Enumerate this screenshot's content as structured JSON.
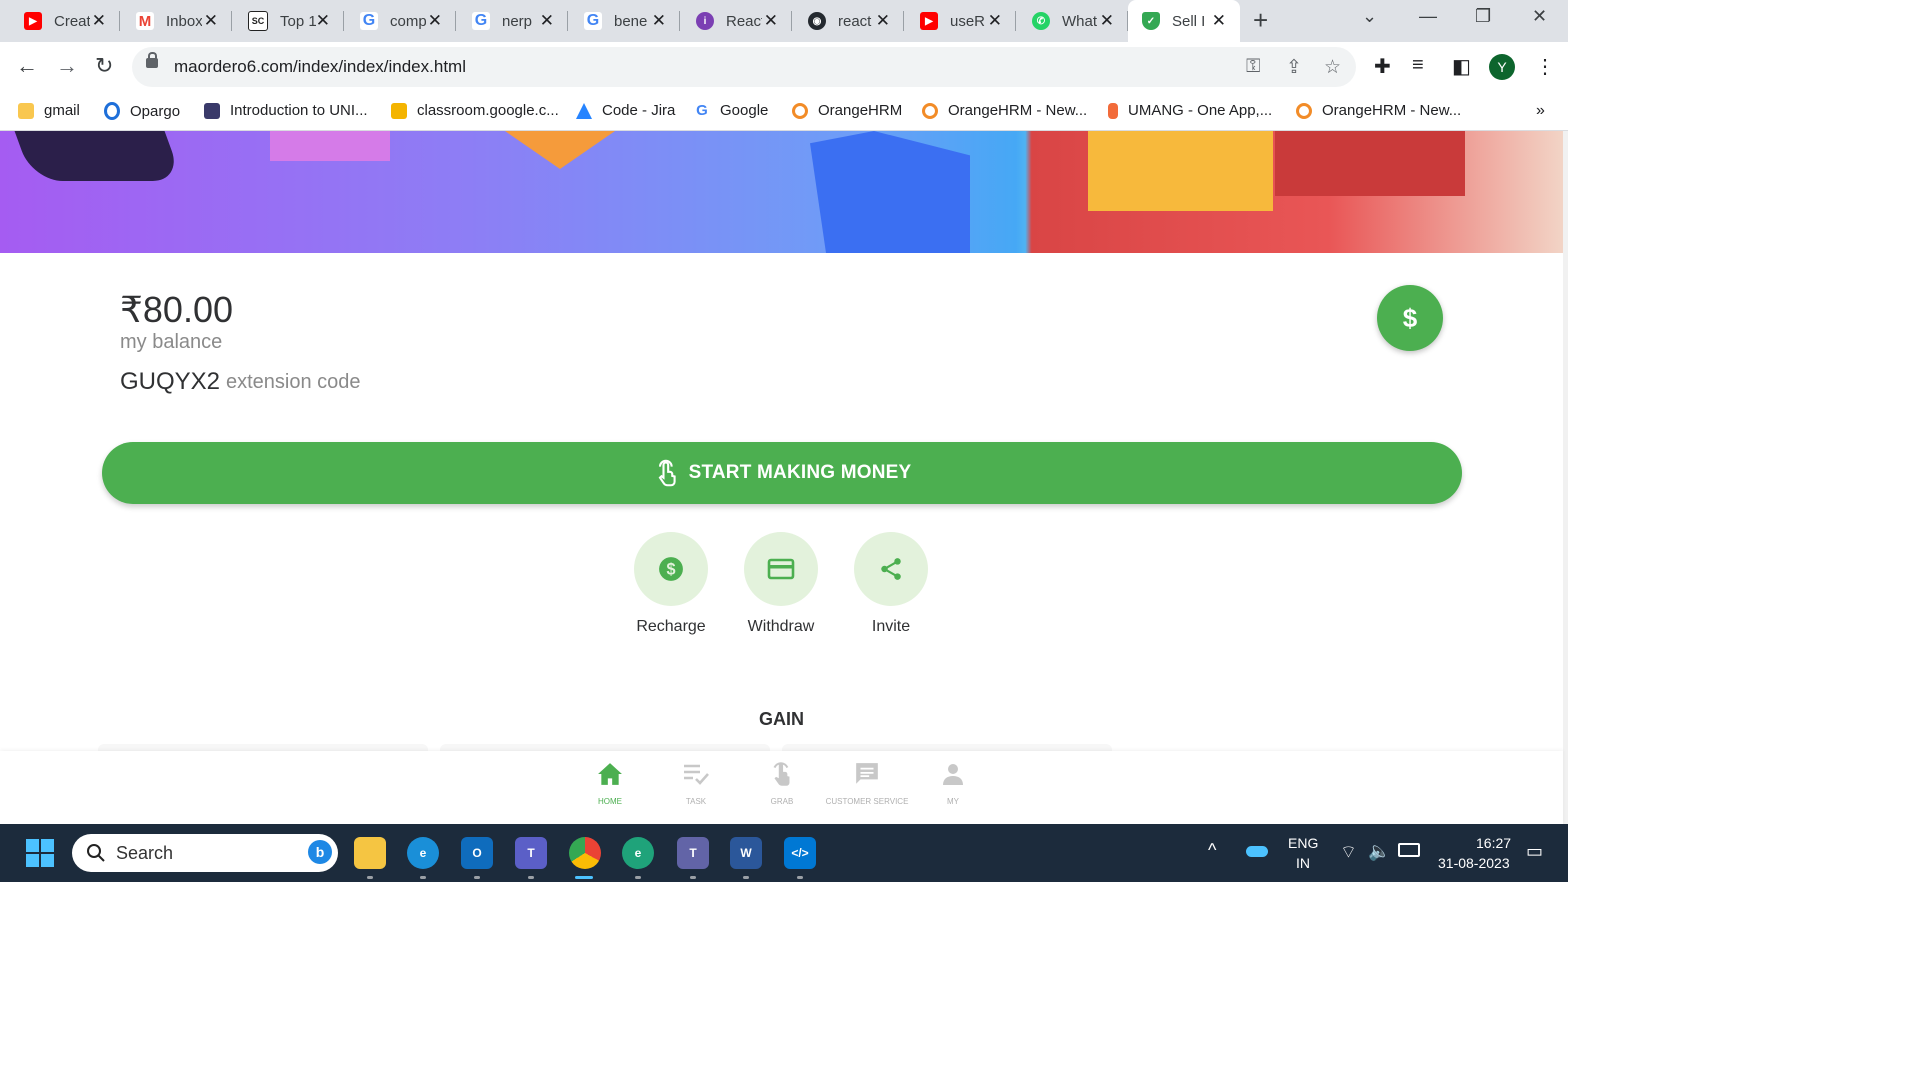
{
  "browser": {
    "tabs": [
      {
        "title": "Creat",
        "favicon": "youtube-icon",
        "color": "#ff0000"
      },
      {
        "title": "Inbox",
        "favicon": "gmail-icon",
        "color": "#ea4335"
      },
      {
        "title": "Top 1",
        "favicon": "sc-icon",
        "color": "#222222"
      },
      {
        "title": "comp",
        "favicon": "google-icon",
        "color": "#4285f4"
      },
      {
        "title": "nerp",
        "favicon": "google-icon",
        "color": "#4285f4"
      },
      {
        "title": "bene",
        "favicon": "google-icon",
        "color": "#4285f4"
      },
      {
        "title": "React",
        "favicon": "react-icon",
        "color": "#7b3fb3"
      },
      {
        "title": "react",
        "favicon": "github-icon",
        "color": "#24292f"
      },
      {
        "title": "useR",
        "favicon": "youtube-icon",
        "color": "#ff0000"
      },
      {
        "title": "What",
        "favicon": "whatsapp-icon",
        "color": "#25d366"
      },
      {
        "title": "Sell I",
        "favicon": "shield-icon",
        "color": "#34a853",
        "active": true
      }
    ],
    "url": "maordero6.com/index/index/index.html",
    "bookmarks": [
      {
        "label": "gmail",
        "icon": "folder-icon",
        "color": "#f9c74f"
      },
      {
        "label": "Opargo",
        "icon": "opargo-icon",
        "color": "#1e6fd9"
      },
      {
        "label": "Introduction to UNI...",
        "icon": "book-icon",
        "color": "#3a3a6a"
      },
      {
        "label": "classroom.google.c...",
        "icon": "classroom-icon",
        "color": "#f4b400"
      },
      {
        "label": "Code - Jira",
        "icon": "jira-icon",
        "color": "#2684ff"
      },
      {
        "label": "Google",
        "icon": "google-icon",
        "color": "#4285f4"
      },
      {
        "label": "OrangeHRM",
        "icon": "orangehrm-icon",
        "color": "#f28c28"
      },
      {
        "label": "OrangeHRM - New...",
        "icon": "orangehrm-icon",
        "color": "#f28c28"
      },
      {
        "label": "UMANG - One App,...",
        "icon": "umang-icon",
        "color": "#f26b3a"
      },
      {
        "label": "OrangeHRM - New...",
        "icon": "orangehrm-icon",
        "color": "#f28c28"
      }
    ],
    "profile_initial": "Y",
    "more_bookmarks": "»"
  },
  "page": {
    "balance_amount": "₹80.00",
    "balance_label": "my balance",
    "extension_code": "GUQYX2",
    "extension_label": "extension code",
    "dollar_symbol": "$",
    "start_button_label": "START MAKING MONEY",
    "actions": [
      {
        "label": "Recharge",
        "icon": "dollar-circle-icon"
      },
      {
        "label": "Withdraw",
        "icon": "card-icon"
      },
      {
        "label": "Invite",
        "icon": "share-icon"
      }
    ],
    "section_title": "GAIN",
    "accent_color": "#4caf50"
  },
  "bottom_nav": [
    {
      "label": "HOME",
      "icon": "home-icon",
      "active": true
    },
    {
      "label": "TASK",
      "icon": "task-icon"
    },
    {
      "label": "GRAB",
      "icon": "grab-icon"
    },
    {
      "label": "CUSTOMER SERVICE",
      "icon": "chat-icon"
    },
    {
      "label": "MY",
      "icon": "user-icon"
    }
  ],
  "taskbar": {
    "search_placeholder": "Search",
    "language": "ENG",
    "region": "IN",
    "time": "16:27",
    "date": "31-08-2023"
  }
}
